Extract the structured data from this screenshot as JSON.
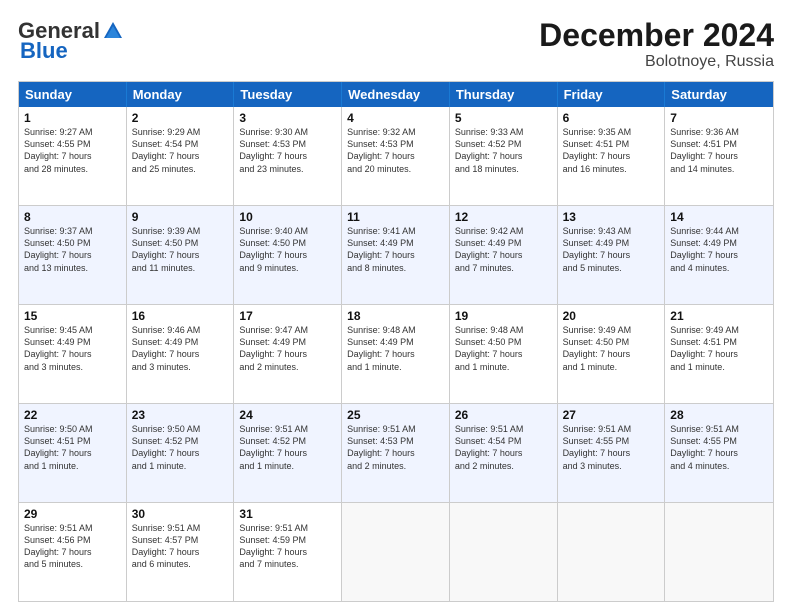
{
  "logo": {
    "general": "General",
    "blue": "Blue"
  },
  "title": "December 2024",
  "location": "Bolotnoye, Russia",
  "days": [
    "Sunday",
    "Monday",
    "Tuesday",
    "Wednesday",
    "Thursday",
    "Friday",
    "Saturday"
  ],
  "rows": [
    [
      {
        "day": "1",
        "lines": [
          "Sunrise: 9:27 AM",
          "Sunset: 4:55 PM",
          "Daylight: 7 hours",
          "and 28 minutes."
        ]
      },
      {
        "day": "2",
        "lines": [
          "Sunrise: 9:29 AM",
          "Sunset: 4:54 PM",
          "Daylight: 7 hours",
          "and 25 minutes."
        ]
      },
      {
        "day": "3",
        "lines": [
          "Sunrise: 9:30 AM",
          "Sunset: 4:53 PM",
          "Daylight: 7 hours",
          "and 23 minutes."
        ]
      },
      {
        "day": "4",
        "lines": [
          "Sunrise: 9:32 AM",
          "Sunset: 4:53 PM",
          "Daylight: 7 hours",
          "and 20 minutes."
        ]
      },
      {
        "day": "5",
        "lines": [
          "Sunrise: 9:33 AM",
          "Sunset: 4:52 PM",
          "Daylight: 7 hours",
          "and 18 minutes."
        ]
      },
      {
        "day": "6",
        "lines": [
          "Sunrise: 9:35 AM",
          "Sunset: 4:51 PM",
          "Daylight: 7 hours",
          "and 16 minutes."
        ]
      },
      {
        "day": "7",
        "lines": [
          "Sunrise: 9:36 AM",
          "Sunset: 4:51 PM",
          "Daylight: 7 hours",
          "and 14 minutes."
        ]
      }
    ],
    [
      {
        "day": "8",
        "lines": [
          "Sunrise: 9:37 AM",
          "Sunset: 4:50 PM",
          "Daylight: 7 hours",
          "and 13 minutes."
        ]
      },
      {
        "day": "9",
        "lines": [
          "Sunrise: 9:39 AM",
          "Sunset: 4:50 PM",
          "Daylight: 7 hours",
          "and 11 minutes."
        ]
      },
      {
        "day": "10",
        "lines": [
          "Sunrise: 9:40 AM",
          "Sunset: 4:50 PM",
          "Daylight: 7 hours",
          "and 9 minutes."
        ]
      },
      {
        "day": "11",
        "lines": [
          "Sunrise: 9:41 AM",
          "Sunset: 4:49 PM",
          "Daylight: 7 hours",
          "and 8 minutes."
        ]
      },
      {
        "day": "12",
        "lines": [
          "Sunrise: 9:42 AM",
          "Sunset: 4:49 PM",
          "Daylight: 7 hours",
          "and 7 minutes."
        ]
      },
      {
        "day": "13",
        "lines": [
          "Sunrise: 9:43 AM",
          "Sunset: 4:49 PM",
          "Daylight: 7 hours",
          "and 5 minutes."
        ]
      },
      {
        "day": "14",
        "lines": [
          "Sunrise: 9:44 AM",
          "Sunset: 4:49 PM",
          "Daylight: 7 hours",
          "and 4 minutes."
        ]
      }
    ],
    [
      {
        "day": "15",
        "lines": [
          "Sunrise: 9:45 AM",
          "Sunset: 4:49 PM",
          "Daylight: 7 hours",
          "and 3 minutes."
        ]
      },
      {
        "day": "16",
        "lines": [
          "Sunrise: 9:46 AM",
          "Sunset: 4:49 PM",
          "Daylight: 7 hours",
          "and 3 minutes."
        ]
      },
      {
        "day": "17",
        "lines": [
          "Sunrise: 9:47 AM",
          "Sunset: 4:49 PM",
          "Daylight: 7 hours",
          "and 2 minutes."
        ]
      },
      {
        "day": "18",
        "lines": [
          "Sunrise: 9:48 AM",
          "Sunset: 4:49 PM",
          "Daylight: 7 hours",
          "and 1 minute."
        ]
      },
      {
        "day": "19",
        "lines": [
          "Sunrise: 9:48 AM",
          "Sunset: 4:50 PM",
          "Daylight: 7 hours",
          "and 1 minute."
        ]
      },
      {
        "day": "20",
        "lines": [
          "Sunrise: 9:49 AM",
          "Sunset: 4:50 PM",
          "Daylight: 7 hours",
          "and 1 minute."
        ]
      },
      {
        "day": "21",
        "lines": [
          "Sunrise: 9:49 AM",
          "Sunset: 4:51 PM",
          "Daylight: 7 hours",
          "and 1 minute."
        ]
      }
    ],
    [
      {
        "day": "22",
        "lines": [
          "Sunrise: 9:50 AM",
          "Sunset: 4:51 PM",
          "Daylight: 7 hours",
          "and 1 minute."
        ]
      },
      {
        "day": "23",
        "lines": [
          "Sunrise: 9:50 AM",
          "Sunset: 4:52 PM",
          "Daylight: 7 hours",
          "and 1 minute."
        ]
      },
      {
        "day": "24",
        "lines": [
          "Sunrise: 9:51 AM",
          "Sunset: 4:52 PM",
          "Daylight: 7 hours",
          "and 1 minute."
        ]
      },
      {
        "day": "25",
        "lines": [
          "Sunrise: 9:51 AM",
          "Sunset: 4:53 PM",
          "Daylight: 7 hours",
          "and 2 minutes."
        ]
      },
      {
        "day": "26",
        "lines": [
          "Sunrise: 9:51 AM",
          "Sunset: 4:54 PM",
          "Daylight: 7 hours",
          "and 2 minutes."
        ]
      },
      {
        "day": "27",
        "lines": [
          "Sunrise: 9:51 AM",
          "Sunset: 4:55 PM",
          "Daylight: 7 hours",
          "and 3 minutes."
        ]
      },
      {
        "day": "28",
        "lines": [
          "Sunrise: 9:51 AM",
          "Sunset: 4:55 PM",
          "Daylight: 7 hours",
          "and 4 minutes."
        ]
      }
    ],
    [
      {
        "day": "29",
        "lines": [
          "Sunrise: 9:51 AM",
          "Sunset: 4:56 PM",
          "Daylight: 7 hours",
          "and 5 minutes."
        ]
      },
      {
        "day": "30",
        "lines": [
          "Sunrise: 9:51 AM",
          "Sunset: 4:57 PM",
          "Daylight: 7 hours",
          "and 6 minutes."
        ]
      },
      {
        "day": "31",
        "lines": [
          "Sunrise: 9:51 AM",
          "Sunset: 4:59 PM",
          "Daylight: 7 hours",
          "and 7 minutes."
        ]
      },
      {
        "day": "",
        "lines": []
      },
      {
        "day": "",
        "lines": []
      },
      {
        "day": "",
        "lines": []
      },
      {
        "day": "",
        "lines": []
      }
    ]
  ]
}
